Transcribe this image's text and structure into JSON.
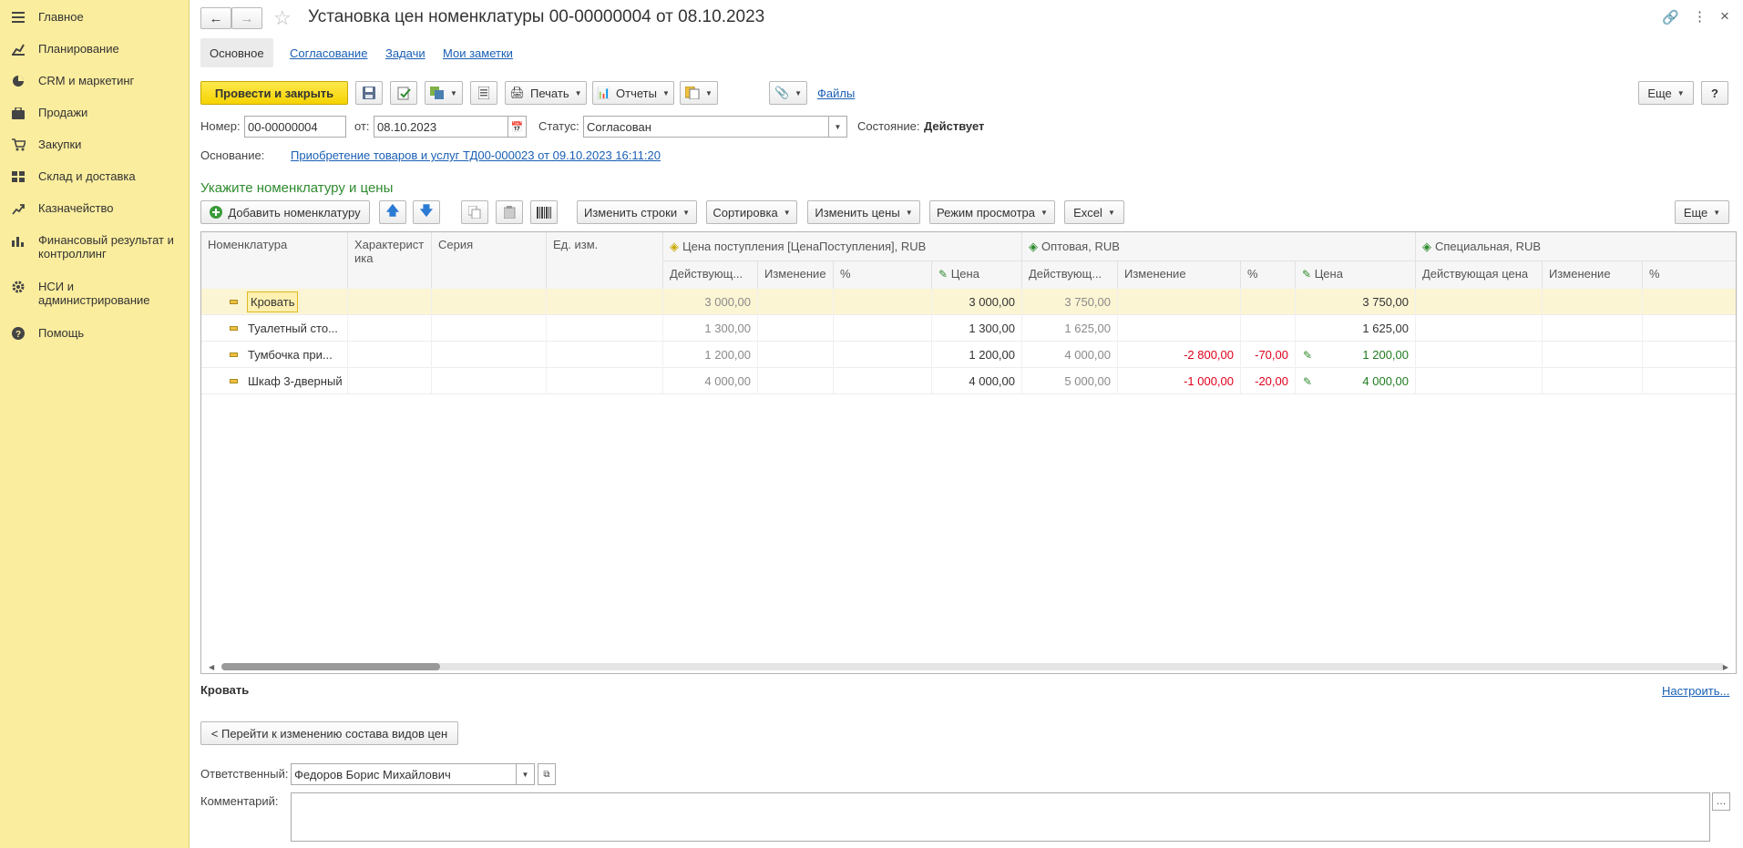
{
  "sidebar": {
    "items": [
      {
        "label": "Главное",
        "icon": "menu-icon"
      },
      {
        "label": "Планирование",
        "icon": "planning-icon"
      },
      {
        "label": "CRM и маркетинг",
        "icon": "pie-icon"
      },
      {
        "label": "Продажи",
        "icon": "briefcase-icon"
      },
      {
        "label": "Закупки",
        "icon": "cart-icon"
      },
      {
        "label": "Склад и доставка",
        "icon": "warehouse-icon"
      },
      {
        "label": "Казначейство",
        "icon": "treasury-icon"
      },
      {
        "label": "Финансовый результат и контроллинг",
        "icon": "barchart-icon"
      },
      {
        "label": "НСИ и администрирование",
        "icon": "gear-icon"
      },
      {
        "label": "Помощь",
        "icon": "help-icon"
      }
    ]
  },
  "header": {
    "title": "Установка цен номенклатуры 00-00000004 от 08.10.2023"
  },
  "tabs": [
    "Основное",
    "Согласование",
    "Задачи",
    "Мои заметки"
  ],
  "toolbar": {
    "post_close": "Провести и закрыть",
    "print": "Печать",
    "reports": "Отчеты",
    "files": "Файлы",
    "more": "Еще",
    "help": "?"
  },
  "form": {
    "number_label": "Номер:",
    "number": "00-00000004",
    "date_label": "от:",
    "date": "08.10.2023",
    "status_label": "Статус:",
    "status": "Согласован",
    "state_label": "Состояние:",
    "state": "Действует",
    "basis_label": "Основание:",
    "basis": "Приобретение товаров и услуг ТД00-000023 от 09.10.2023 16:11:20"
  },
  "section_title": "Укажите номенклатуру и цены",
  "table_toolbar": {
    "add": "Добавить номенклатуру",
    "change_rows": "Изменить строки",
    "sort": "Сортировка",
    "change_prices": "Изменить цены",
    "view_mode": "Режим просмотра",
    "excel": "Excel",
    "more": "Еще"
  },
  "table": {
    "headers": {
      "nomenclature": "Номенклатура",
      "characteristic": "Характеристика",
      "series": "Серия",
      "unit": "Ед. изм.",
      "group1": "Цена поступления [ЦенаПоступления], RUB",
      "group2": "Оптовая, RUB",
      "group3": "Специальная, RUB",
      "current_short": "Действующ...",
      "current_full": "Действующая цена",
      "change": "Изменение",
      "percent": "%",
      "price": "Цена"
    },
    "rows": [
      {
        "name": "Кровать",
        "p_cur": "3 000,00",
        "p_price": "3 000,00",
        "w_cur": "3 750,00",
        "w_change": "",
        "w_pct": "",
        "w_price": "3 750,00"
      },
      {
        "name": "Туалетный сто...",
        "p_cur": "1 300,00",
        "p_price": "1 300,00",
        "w_cur": "1 625,00",
        "w_change": "",
        "w_pct": "",
        "w_price": "1 625,00"
      },
      {
        "name": "Тумбочка при...",
        "p_cur": "1 200,00",
        "p_price": "1 200,00",
        "w_cur": "4 000,00",
        "w_change": "-2 800,00",
        "w_pct": "-70,00",
        "w_price": "1 200,00"
      },
      {
        "name": "Шкаф 3-дверный",
        "p_cur": "4 000,00",
        "p_price": "4 000,00",
        "w_cur": "5 000,00",
        "w_change": "-1 000,00",
        "w_pct": "-20,00",
        "w_price": "4 000,00"
      }
    ]
  },
  "bottom": {
    "selected_item": "Кровать",
    "configure": "Настроить...",
    "go_back": "< Перейти к изменению состава видов цен",
    "responsible_label": "Ответственный:",
    "responsible": "Федоров Борис Михайлович",
    "comment_label": "Комментарий:",
    "comment": ""
  }
}
